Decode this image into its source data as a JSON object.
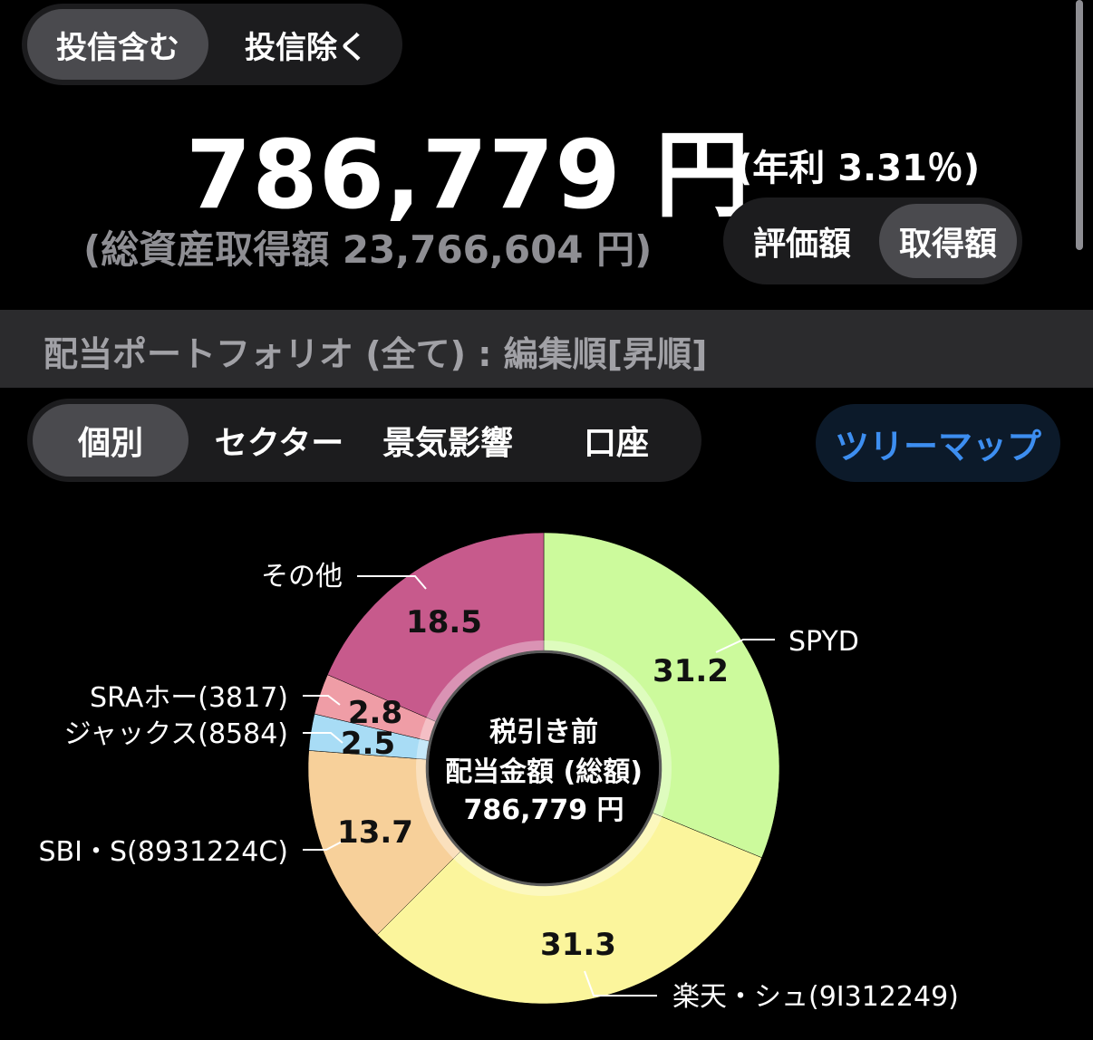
{
  "scope_toggle": {
    "options": [
      "投信含む",
      "投信除く"
    ],
    "selected": "投信含む"
  },
  "summary": {
    "amount": "786,779 円",
    "rate": "(年利 3.31％)",
    "cost": "(総資産取得額 23,766,604 円)"
  },
  "value_toggle": {
    "options": [
      "評価額",
      "取得額"
    ],
    "selected": "取得額"
  },
  "section_title": "配当ポートフォリオ (全て) : 編集順[昇順]",
  "group_tabs": {
    "options": [
      "個別",
      "セクター",
      "景気影響",
      "口座"
    ],
    "selected": "個別"
  },
  "treemap_label": "ツリーマップ",
  "colors": {
    "accent": "#3d8ef0",
    "background": "#000000",
    "segment_bg": "#1c1c1e",
    "segment_active": "#4a4a4e"
  },
  "chart_data": {
    "type": "pie",
    "donut": true,
    "center_text": [
      "税引き前",
      "配当金額 (総額)",
      "786,779 円"
    ],
    "slices": [
      {
        "label": "SPYD",
        "value": 31.2,
        "color": "#ccfa9c"
      },
      {
        "label": "楽天・シュ(9I312249)",
        "value": 31.3,
        "color": "#fbf59c"
      },
      {
        "label": "SBI・S(8931224C)",
        "value": 13.7,
        "color": "#f7d09a"
      },
      {
        "label": "ジャックス(8584)",
        "value": 2.5,
        "color": "#a8dcf5"
      },
      {
        "label": "SRAホー(3817)",
        "value": 2.8,
        "color": "#ef9da6"
      },
      {
        "label": "その他",
        "value": 18.5,
        "color": "#c75a8c"
      }
    ]
  }
}
